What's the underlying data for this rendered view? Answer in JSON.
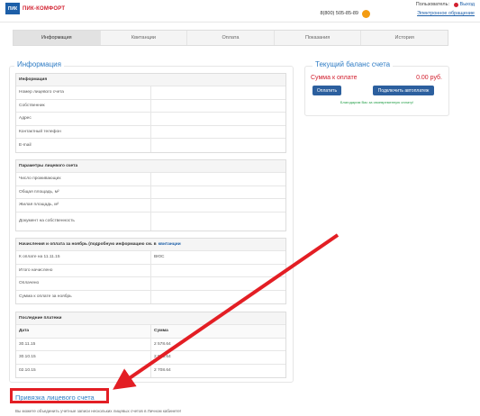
{
  "header": {
    "logo_mark": "ПИК",
    "logo_text": "ПИК-КОМФОРТ",
    "user_label": "Пользователь:",
    "logout_label": "Выход",
    "phone": "8(800) 505-85-89",
    "e_appeal": "Электронное обращение"
  },
  "tabs": [
    {
      "label": "Информация",
      "active": true
    },
    {
      "label": "Квитанции",
      "active": false
    },
    {
      "label": "Оплата",
      "active": false
    },
    {
      "label": "Показания",
      "active": false
    },
    {
      "label": "История",
      "active": false
    }
  ],
  "info": {
    "section_title": "Информация",
    "general_header": "Информация",
    "general_rows": [
      "Номер лицевого счета",
      "Собственник",
      "Адрес",
      "Контактный телефон",
      "E-mail"
    ],
    "property_header": "Параметры лицевого счета",
    "property_rows": [
      "Число проживающих",
      "Общая площадь, м²",
      "Жилая площадь, м²",
      "Документ на собственность"
    ],
    "charges_header": "Начисления и оплата за ноябрь (подробную информацию см. в",
    "charges_link": "квитанции",
    "charges_rows": [
      {
        "label": "К оплате на 11.11.15",
        "value": "ВЮС"
      },
      {
        "label": "Итого начислено",
        "value": ""
      },
      {
        "label": "Оплачено",
        "value": ""
      },
      {
        "label": "Сумма к оплате за ноябрь",
        "value": ""
      }
    ],
    "payments_header": "Последние платежи",
    "payments_columns": [
      "Дата",
      "Сумма"
    ],
    "payments": [
      {
        "date": "30.11.15",
        "amount": "2 578.64"
      },
      {
        "date": "30.10.15",
        "amount": "2 578.64"
      },
      {
        "date": "02.10.15",
        "amount": "2 708.64"
      }
    ]
  },
  "balance": {
    "title": "Текущий баланс счета",
    "due_label": "Сумма к оплате",
    "due_value": "0.00 руб.",
    "pay_button": "Оплатить",
    "autopay_button": "Подключить автоплатеж",
    "note": "Благодарим Вас за своевременную оплату!"
  },
  "binding": {
    "title": "Привязка лицевого счета",
    "note": "Вы можете объединить учетные записи нескольких лицевых счетов в Личном кабинете!"
  },
  "colors": {
    "brand_blue": "#1d5fa8",
    "brand_red": "#d2202f",
    "annotation_red": "#e31e24"
  }
}
